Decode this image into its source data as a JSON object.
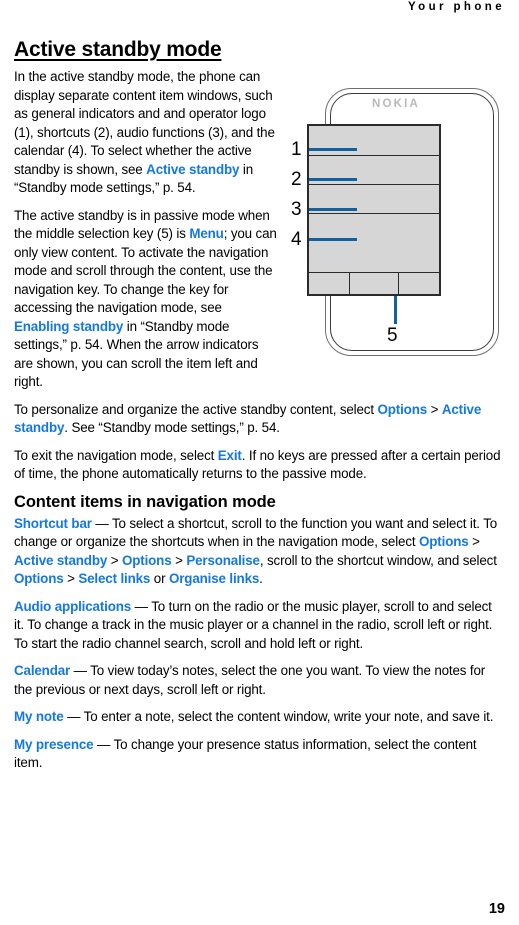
{
  "header": {
    "running_head": "Your phone"
  },
  "page_number": "19",
  "headings": {
    "h1": "Active standby mode",
    "h2": "Content items in navigation mode"
  },
  "colors": {
    "link": "#1478e0",
    "leader_line": "#12619e",
    "screen_fill": "#d6d6d6",
    "logo_gray": "#b9b9b9"
  },
  "paragraphs": {
    "p1": {
      "t1": "In the active standby mode, the phone can display separate content item windows, such as general indicators and and operator logo (1), shortcuts (2), audio functions (3), and the calendar (4). To select whether the active standby is shown, see ",
      "link1": "Active standby",
      "t2": " in “Standby mode settings,” p. 54."
    },
    "p2": {
      "t1": "The active standby is in passive mode when the middle selection key (5) is ",
      "link1": "Menu",
      "t2": "; you can only view content. To activate the navigation mode and scroll through the content, use the navigation key. To change the key for accessing the navigation mode, see ",
      "link2": "Enabling standby",
      "t3": " in “Standby mode settings,” p. 54. When the arrow indicators are shown, you can scroll the item left and right."
    },
    "p3": {
      "t1": "To personalize and organize the active standby content, select ",
      "link1": "Options",
      "sep1": " > ",
      "link2": "Active standby",
      "t2": ". See “Standby mode settings,” p. 54."
    },
    "p4": {
      "t1": "To exit the navigation mode, select ",
      "link1": "Exit",
      "t2": ". If no keys are pressed after a certain period of time, the phone automatically returns to the passive mode."
    },
    "p5": {
      "link1": "Shortcut bar",
      "t1": " — To select a shortcut, scroll to the function you want and select it. To change or organize the shortcuts when in the navigation mode, select ",
      "link2": "Options",
      "sep1": " > ",
      "link3": "Active standby",
      "sep2": " > ",
      "link4": "Options",
      "sep3": " > ",
      "link5": "Personalise",
      "t2": ", scroll to the shortcut window, and select ",
      "link6": "Options",
      "sep4": " > ",
      "link7": "Select links",
      "t3": " or ",
      "link8": "Organise links",
      "t4": "."
    },
    "p6": {
      "link1": "Audio applications",
      "t1": " — To turn on the radio or the music player, scroll to and select it. To change a track in the music player or a channel in the radio, scroll left or right. To start the radio channel search, scroll and hold left or right."
    },
    "p7": {
      "link1": "Calendar",
      "t1": " — To view today’s notes, select the one you want. To view the notes for the previous or next days, scroll left or right."
    },
    "p8": {
      "link1": "My note",
      "t1": " — To enter a note, select the content window, write your note, and save it."
    },
    "p9": {
      "link1": "My presence",
      "t1": " — To change your presence status information, select the content item."
    }
  },
  "figure": {
    "brand_logo": "NOKIA",
    "callouts": [
      "1",
      "2",
      "3",
      "4",
      "5"
    ],
    "callout_meanings": [
      "general indicators and operator logo",
      "shortcuts",
      "audio functions",
      "calendar",
      "middle selection key"
    ]
  }
}
